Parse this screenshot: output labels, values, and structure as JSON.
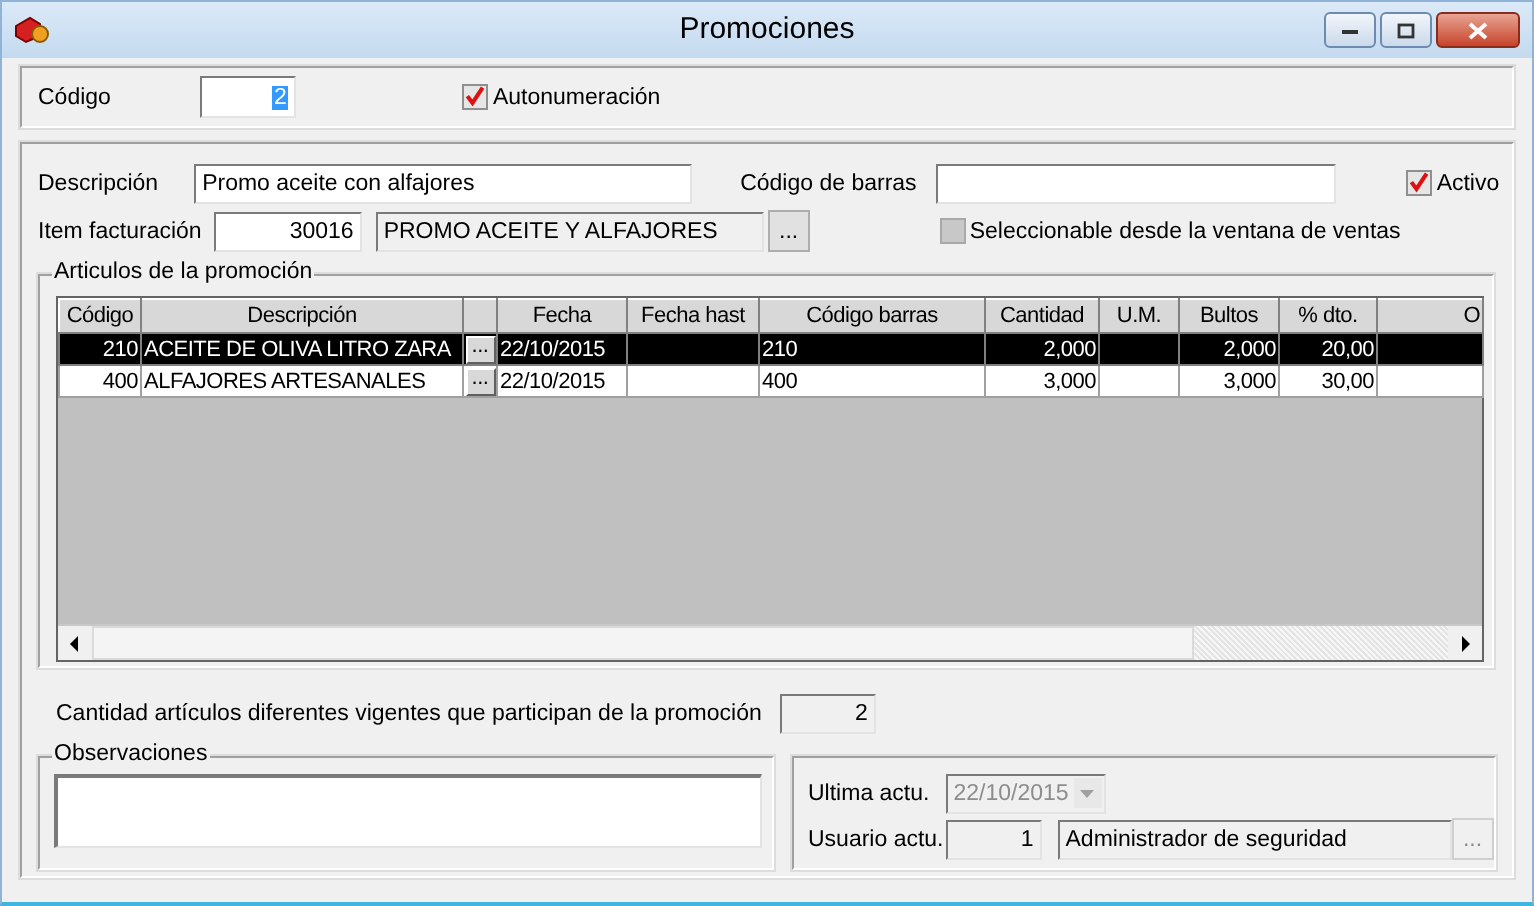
{
  "window": {
    "title": "Promociones"
  },
  "codigo": {
    "label": "Código",
    "value": "2",
    "highlighted": true
  },
  "autonumeracion": {
    "label": "Autonumeración",
    "checked": true
  },
  "descripcion": {
    "label": "Descripción",
    "value": "Promo aceite con alfajores"
  },
  "codigo_barras": {
    "label": "Código de barras"
  },
  "activo": {
    "label": "Activo",
    "checked": true
  },
  "item_facturacion": {
    "label": "Item facturación",
    "code": "30016",
    "name": "PROMO ACEITE Y ALFAJORES",
    "button": "..."
  },
  "seleccionable": {
    "label": "Seleccionable desde la ventana de ventas",
    "checked": false,
    "disabled": true
  },
  "articulos": {
    "title": "Articulos de la promoción",
    "columns": [
      {
        "label": "Código",
        "kind": "number"
      },
      {
        "label": "Descripción",
        "kind": "text"
      },
      {
        "kind": "button"
      },
      {
        "label": "Fecha",
        "kind": "text"
      },
      {
        "label": "Fecha  hast",
        "kind": "text"
      },
      {
        "label": "Código barras",
        "kind": "text"
      },
      {
        "label": "Cantidad",
        "kind": "number"
      },
      {
        "label": "U.M.",
        "kind": "text"
      },
      {
        "label": "Bultos",
        "kind": "number"
      },
      {
        "label": "% dto.",
        "kind": "number"
      },
      {
        "label": "O",
        "kind": "text"
      }
    ],
    "rows": [
      {
        "selected": true,
        "cells": [
          "210",
          "ACEITE DE OLIVA LITRO ZARA",
          "...",
          "22/10/2015",
          null,
          "210",
          "2,000",
          null,
          "2,000",
          "20,00",
          null
        ]
      },
      {
        "selected": false,
        "cells": [
          "400",
          "ALFAJORES ARTESANALES",
          "...",
          "22/10/2015",
          null,
          "400",
          "3,000",
          null,
          "3,000",
          "30,00",
          null
        ]
      }
    ]
  },
  "cantidad_articulos": {
    "label": "Cantidad artículos diferentes vigentes que participan de la promoción",
    "value": "2"
  },
  "observaciones": {
    "title": "Observaciones"
  },
  "ultima_actu": {
    "label": "Ultima actu.",
    "value": "22/10/2015",
    "disabled": true
  },
  "usuario_actu": {
    "label": "Usuario actu.",
    "code": "1",
    "name": "Administrador de seguridad",
    "button": "...",
    "button_disabled": true
  }
}
